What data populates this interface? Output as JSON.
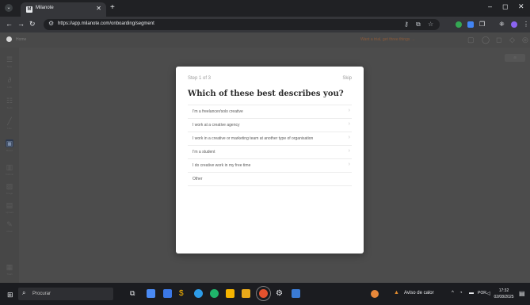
{
  "browser": {
    "tab_title": "Milanote",
    "tab_favicon_letter": "M",
    "url": "https://app.milanote.com/onboarding/segment",
    "window_controls": [
      "–",
      "◻",
      "✕"
    ]
  },
  "app": {
    "board_name": "Home",
    "trial_banner": "Want a trial, get three things →",
    "rail_labels": [
      "Note",
      "Link",
      "To-do",
      "Line",
      "Board",
      "Column",
      "Image",
      "Upload",
      "Draw",
      "Trash"
    ]
  },
  "modal": {
    "step": "Step 1 of 3",
    "skip_label": "Skip",
    "question": "Which of these best describes you?",
    "options": [
      "I'm a freelancer/solo creative",
      "I work at a creative agency",
      "I work in a creative or marketing team at another type of organisation",
      "I'm a student",
      "I do creative work in my free time",
      "Other"
    ]
  },
  "taskbar": {
    "search_placeholder": "Procurar",
    "weather_text": "Aviso de calor",
    "language": "POR",
    "time": "17:32",
    "date": "02/08/2025"
  },
  "colors": {
    "modal_bg": "#ffffff",
    "overlay": "#4c4c4c",
    "taskbar": "#1b1c20"
  }
}
